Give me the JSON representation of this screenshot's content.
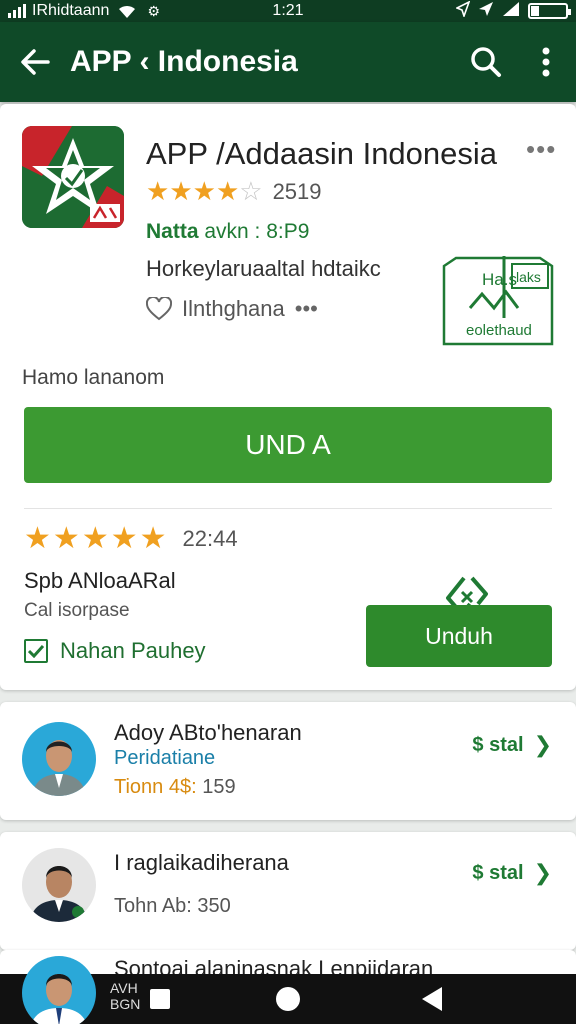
{
  "status_bar": {
    "carrier": "IRhidtaann",
    "time": "1:21"
  },
  "app_bar": {
    "title": "APP ‹ Indonesia"
  },
  "app": {
    "name": "APP /Addaasin Indonesia",
    "rating_value": 3.5,
    "rating_count": "2519",
    "developer_label": "Natta",
    "developer_rest": "avkn : 8:P9",
    "description": "Horkeylaruaaltal hdtaikc",
    "wishlist_label": "Ilnthghana",
    "badge_top": "Ha.s",
    "badge_tag": "laks",
    "badge_bottom": "eolethaud",
    "section_label": "Hamo lananom",
    "install_label": "UND A"
  },
  "publisher": {
    "rating_value": 4.5,
    "rating_text": "22:44",
    "name": "Spb ANloaARal",
    "subtitle": "Cal isorpase",
    "checkbox_label": "Nahan Pauhey",
    "checked": true,
    "download_label": "Unduh"
  },
  "list": [
    {
      "name": "Adoy ABto'henaran",
      "category": "Peridatiane",
      "meta_label": "Tionn 4$:",
      "meta_value": "159",
      "price": "$ stal"
    },
    {
      "name": "I raglaikadiherana",
      "category": "",
      "meta_label": "Tohn Ab:",
      "meta_value": "350",
      "price": "$ stal"
    },
    {
      "name": "Sontoai alaninasnak Lenpiidaran",
      "category": "",
      "meta_label": "",
      "meta_value": "",
      "price": ""
    }
  ],
  "nav_bar": {
    "overlay_line1": "AVH",
    "overlay_line2": "BGN"
  },
  "colors": {
    "app_bar": "#0f4a28",
    "accent_green": "#3c9a32",
    "star": "#f0a020"
  }
}
